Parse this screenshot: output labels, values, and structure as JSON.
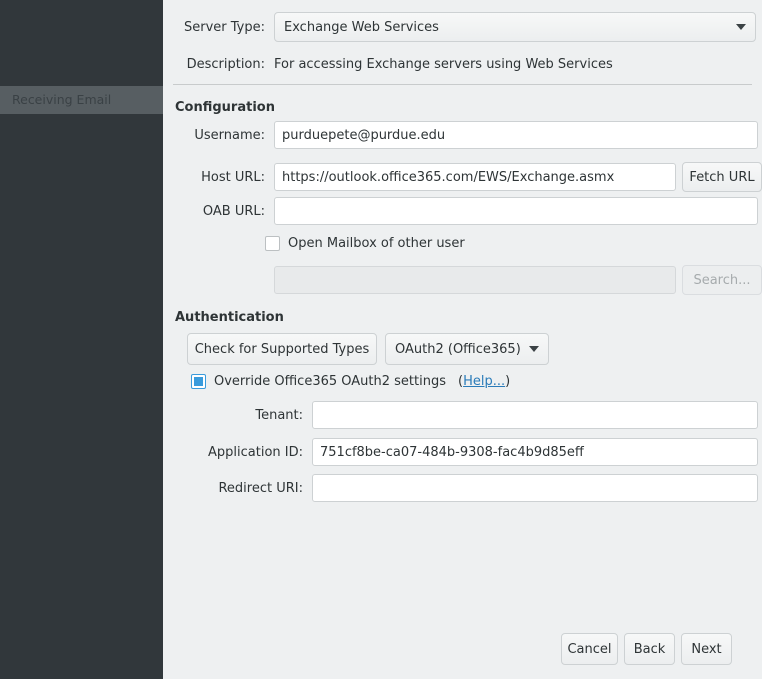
{
  "sidebar": {
    "items": [
      {
        "label": "Receiving Email",
        "selected": true
      }
    ]
  },
  "server_type": {
    "label": "Server Type:",
    "value": "Exchange Web Services",
    "arrow_icon": "chevron-down-icon"
  },
  "description": {
    "label": "Description:",
    "value": "For accessing Exchange servers using Web Services"
  },
  "configuration": {
    "title": "Configuration",
    "username": {
      "label": "Username:",
      "value": "purduepete@purdue.edu",
      "placeholder": ""
    },
    "host_url": {
      "label": "Host URL:",
      "value": "https://outlook.office365.com/EWS/Exchange.asmx",
      "placeholder": ""
    },
    "fetch_url_button": "Fetch URL",
    "oab_url": {
      "label": "OAB URL:",
      "value": "",
      "placeholder": ""
    },
    "open_mailbox": {
      "label": "Open Mailbox of other user",
      "checked": false
    },
    "mailbox_user": {
      "value": "",
      "placeholder": ""
    },
    "search_button": "Search..."
  },
  "authentication": {
    "title": "Authentication",
    "check_types_button": "Check for Supported Types",
    "auth_method": {
      "value": "OAuth2 (Office365)",
      "arrow_icon": "chevron-down-icon"
    },
    "override": {
      "label": "Override Office365 OAuth2 settings",
      "checked": true,
      "help_open_paren": "(",
      "help_link": "Help...",
      "help_close_paren": ")"
    },
    "tenant": {
      "label": "Tenant:",
      "value": "",
      "placeholder": ""
    },
    "application_id": {
      "label": "Application ID:",
      "value": "751cf8be-ca07-484b-9308-fac4b9d85eff",
      "placeholder": ""
    },
    "redirect_uri": {
      "label": "Redirect URI:",
      "value": "",
      "placeholder": ""
    }
  },
  "footer": {
    "cancel": "Cancel",
    "back": "Back",
    "next": "Next"
  },
  "colors": {
    "sidebar_bg": "#31373b",
    "sidebar_selected_bg": "#575e62",
    "panel_bg": "#eef0f1",
    "accent_blue": "#3a9bdc",
    "link_blue": "#2a7bb9"
  }
}
